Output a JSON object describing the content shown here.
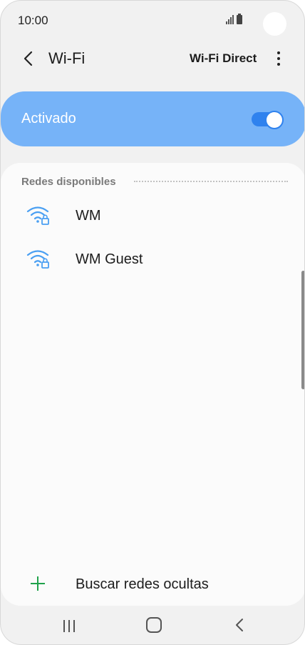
{
  "status_bar": {
    "time": "10:00",
    "icons": [
      "signal-icon",
      "battery-icon"
    ]
  },
  "header": {
    "back_icon": "chevron-left-icon",
    "title": "Wi-Fi",
    "wifi_direct_label": "Wi-Fi Direct",
    "more_icon": "more-vert-icon"
  },
  "wifi_toggle": {
    "label": "Activado",
    "checked": true,
    "card_color": "#76b3f8",
    "switch_color": "#2f82ee"
  },
  "networks": {
    "section_title": "Redes disponibles",
    "items": [
      {
        "name": "WM",
        "icon": "wifi-locked-icon"
      },
      {
        "name": "WM Guest",
        "icon": "wifi-locked-icon"
      }
    ],
    "add_hidden_label": "Buscar redes ocultas",
    "add_icon": "plus-icon",
    "add_icon_color": "#1fa24a"
  },
  "nav_bar": {
    "icons": [
      "recent-apps-icon",
      "home-icon",
      "back-icon"
    ]
  }
}
